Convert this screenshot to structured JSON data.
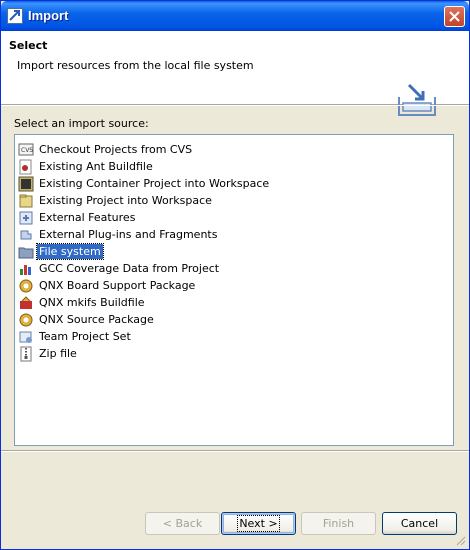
{
  "window": {
    "title": "Import",
    "icon": "import-wizard-icon",
    "close_icon": "close-icon"
  },
  "header": {
    "title": "Select",
    "description": "Import resources from the local file system",
    "icon": "import-tray-icon"
  },
  "source_label": "Select an import source:",
  "sources": [
    {
      "label": "Checkout Projects from CVS",
      "icon": "cvs-icon",
      "selected": false
    },
    {
      "label": "Existing Ant Buildfile",
      "icon": "ant-icon",
      "selected": false
    },
    {
      "label": "Existing Container Project into Workspace",
      "icon": "container-project-icon",
      "selected": false
    },
    {
      "label": "Existing Project into Workspace",
      "icon": "project-icon",
      "selected": false
    },
    {
      "label": "External Features",
      "icon": "features-icon",
      "selected": false
    },
    {
      "label": "External Plug-ins and Fragments",
      "icon": "plugin-icon",
      "selected": false
    },
    {
      "label": "File system",
      "icon": "folder-icon",
      "selected": true
    },
    {
      "label": "GCC Coverage Data from Project",
      "icon": "coverage-chart-icon",
      "selected": false
    },
    {
      "label": "QNX Board Support Package",
      "icon": "qnx-package-icon",
      "selected": false
    },
    {
      "label": "QNX mkifs Buildfile",
      "icon": "qnx-buildfile-icon",
      "selected": false
    },
    {
      "label": "QNX Source Package",
      "icon": "qnx-source-icon",
      "selected": false
    },
    {
      "label": "Team Project Set",
      "icon": "team-project-icon",
      "selected": false
    },
    {
      "label": "Zip file",
      "icon": "zip-icon",
      "selected": false
    }
  ],
  "buttons": {
    "back": "< Back",
    "next": "Next >",
    "finish": "Finish",
    "cancel": "Cancel"
  },
  "colors": {
    "title_bar": "#0054e3",
    "selection": "#316ac5",
    "face": "#ece9d8"
  }
}
